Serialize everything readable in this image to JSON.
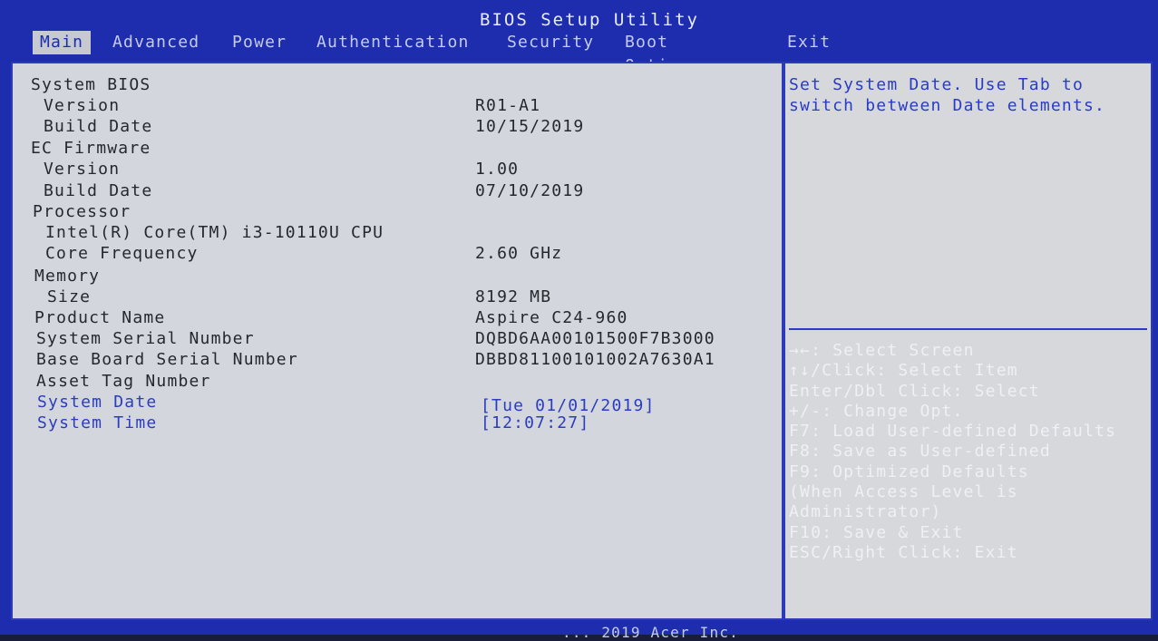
{
  "title": "BIOS Setup Utility",
  "tabs": [
    {
      "label": "Main",
      "active": true
    },
    {
      "label": "Advanced",
      "active": false
    },
    {
      "label": "Power",
      "active": false
    },
    {
      "label": "Authentication",
      "active": false
    },
    {
      "label": "Security",
      "active": false
    },
    {
      "label": "Boot Options",
      "active": false
    },
    {
      "label": "Exit",
      "active": false
    }
  ],
  "main": {
    "rows": [
      {
        "label": "System BIOS",
        "value": ""
      },
      {
        "label": "Version",
        "value": "R01-A1"
      },
      {
        "label": "Build Date",
        "value": "10/15/2019"
      },
      {
        "label": "EC Firmware",
        "value": ""
      },
      {
        "label": "Version",
        "value": "1.00"
      },
      {
        "label": "Build Date",
        "value": "07/10/2019"
      },
      {
        "label": "Processor",
        "value": ""
      },
      {
        "label": "Intel(R) Core(TM) i3-10110U CPU",
        "value": ""
      },
      {
        "label": "Core Frequency",
        "value": "2.60 GHz"
      },
      {
        "label": "Memory",
        "value": ""
      },
      {
        "label": "Size",
        "value": "8192 MB"
      },
      {
        "label": "Product Name",
        "value": "Aspire C24-960"
      },
      {
        "label": "System Serial Number",
        "value": "DQBD6AA00101500F7B3000"
      },
      {
        "label": "Base Board Serial Number",
        "value": "DBBD81100101002A7630A1"
      },
      {
        "label": "Asset Tag Number",
        "value": ""
      },
      {
        "label": "System Date",
        "value": "[Tue 01/01/2019]"
      },
      {
        "label": "System Time",
        "value": "[12:07:27]"
      }
    ]
  },
  "help": {
    "text": "Set System Date. Use Tab to switch between Date elements.",
    "keys": [
      "→←: Select Screen",
      "↑↓/Click: Select Item",
      "Enter/Dbl Click: Select",
      "+/-: Change Opt.",
      "F7: Load User-defined Defaults",
      "F8: Save as User-defined",
      "F9: Optimized Defaults",
      "(When Access Level is",
      "Administrator)",
      "F10: Save & Exit",
      "ESC/Right Click: Exit"
    ]
  },
  "footer": "... 2019 Acer Inc.",
  "colors": {
    "background": "#1e2dae",
    "panel": "#d3d6dc",
    "selected_text": "#2b3dbe",
    "static_text": "#26282e",
    "key_help_text": "#eef0f4"
  }
}
